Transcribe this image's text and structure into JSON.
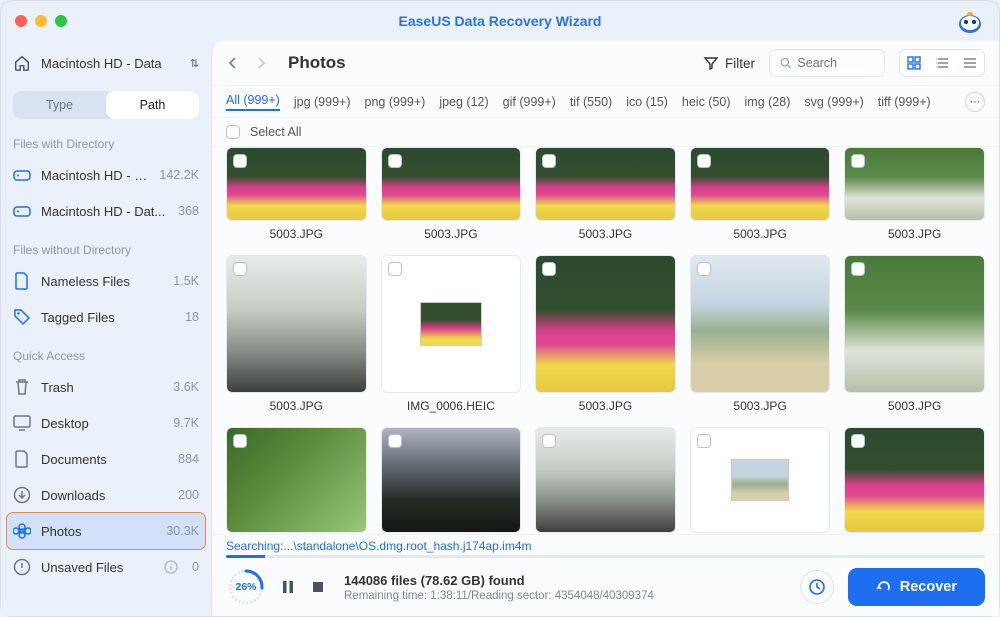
{
  "app": {
    "title": "EaseUS Data Recovery Wizard"
  },
  "drive": {
    "label": "Macintosh HD - Data"
  },
  "segment": {
    "type": "Type",
    "path": "Path"
  },
  "sections": {
    "withDir": "Files with Directory",
    "withoutDir": "Files without Directory",
    "quick": "Quick Access"
  },
  "sidebar": {
    "drives": [
      {
        "label": "Macintosh HD - D...",
        "count": "142.2K"
      },
      {
        "label": "Macintosh HD - Dat...",
        "count": "368"
      }
    ],
    "nodir": [
      {
        "label": "Nameless Files",
        "count": "1.5K"
      },
      {
        "label": "Tagged Files",
        "count": "18"
      }
    ],
    "quick": [
      {
        "label": "Trash",
        "count": "3.6K"
      },
      {
        "label": "Desktop",
        "count": "9.7K"
      },
      {
        "label": "Documents",
        "count": "884"
      },
      {
        "label": "Downloads",
        "count": "200"
      },
      {
        "label": "Photos",
        "count": "30.3K"
      },
      {
        "label": "Unsaved Files",
        "count": "0"
      }
    ]
  },
  "toolbar": {
    "breadcrumb": "Photos",
    "filter_label": "Filter",
    "search_placeholder": "Search"
  },
  "filter_tabs": [
    {
      "label": "All (999+)",
      "active": true
    },
    {
      "label": "jpg (999+)"
    },
    {
      "label": "png (999+)"
    },
    {
      "label": "jpeg (12)"
    },
    {
      "label": "gif (999+)"
    },
    {
      "label": "tif (550)"
    },
    {
      "label": "ico (15)"
    },
    {
      "label": "heic (50)"
    },
    {
      "label": "img (28)"
    },
    {
      "label": "svg (999+)"
    },
    {
      "label": "tiff (999+)"
    }
  ],
  "selectall_label": "Select All",
  "grid": {
    "row1": [
      {
        "name": "5003.JPG",
        "img": "img-flowers"
      },
      {
        "name": "5003.JPG",
        "img": "img-flowers"
      },
      {
        "name": "5003.JPG",
        "img": "img-flowers"
      },
      {
        "name": "5003.JPG",
        "img": "img-flowers"
      },
      {
        "name": "5003.JPG",
        "img": "img-greenfall"
      }
    ],
    "row2": [
      {
        "name": "5003.JPG",
        "img": "img-waterfall"
      },
      {
        "name": "IMG_0006.HEIC",
        "img": "img-framed"
      },
      {
        "name": "5003.JPG",
        "img": "img-flowers"
      },
      {
        "name": "5003.JPG",
        "img": "img-beach"
      },
      {
        "name": "5003.JPG",
        "img": "img-greenfall"
      }
    ],
    "row3": [
      {
        "name": "",
        "img": "img-green"
      },
      {
        "name": "",
        "img": "img-darkfall"
      },
      {
        "name": "",
        "img": "img-waterfall"
      },
      {
        "name": "",
        "img": "img-small"
      },
      {
        "name": "",
        "img": "img-flowers"
      }
    ]
  },
  "footer": {
    "path": "Searching:...\\standalone\\OS.dmg.root_hash.j174ap.im4m",
    "progress_pct": 26,
    "progress_label": "26%",
    "found_line": "144086 files (78.62 GB) found",
    "remaining_line": "Remaining time: 1:38:11/Reading sector: 4354048/40309374",
    "recover_label": "Recover"
  }
}
